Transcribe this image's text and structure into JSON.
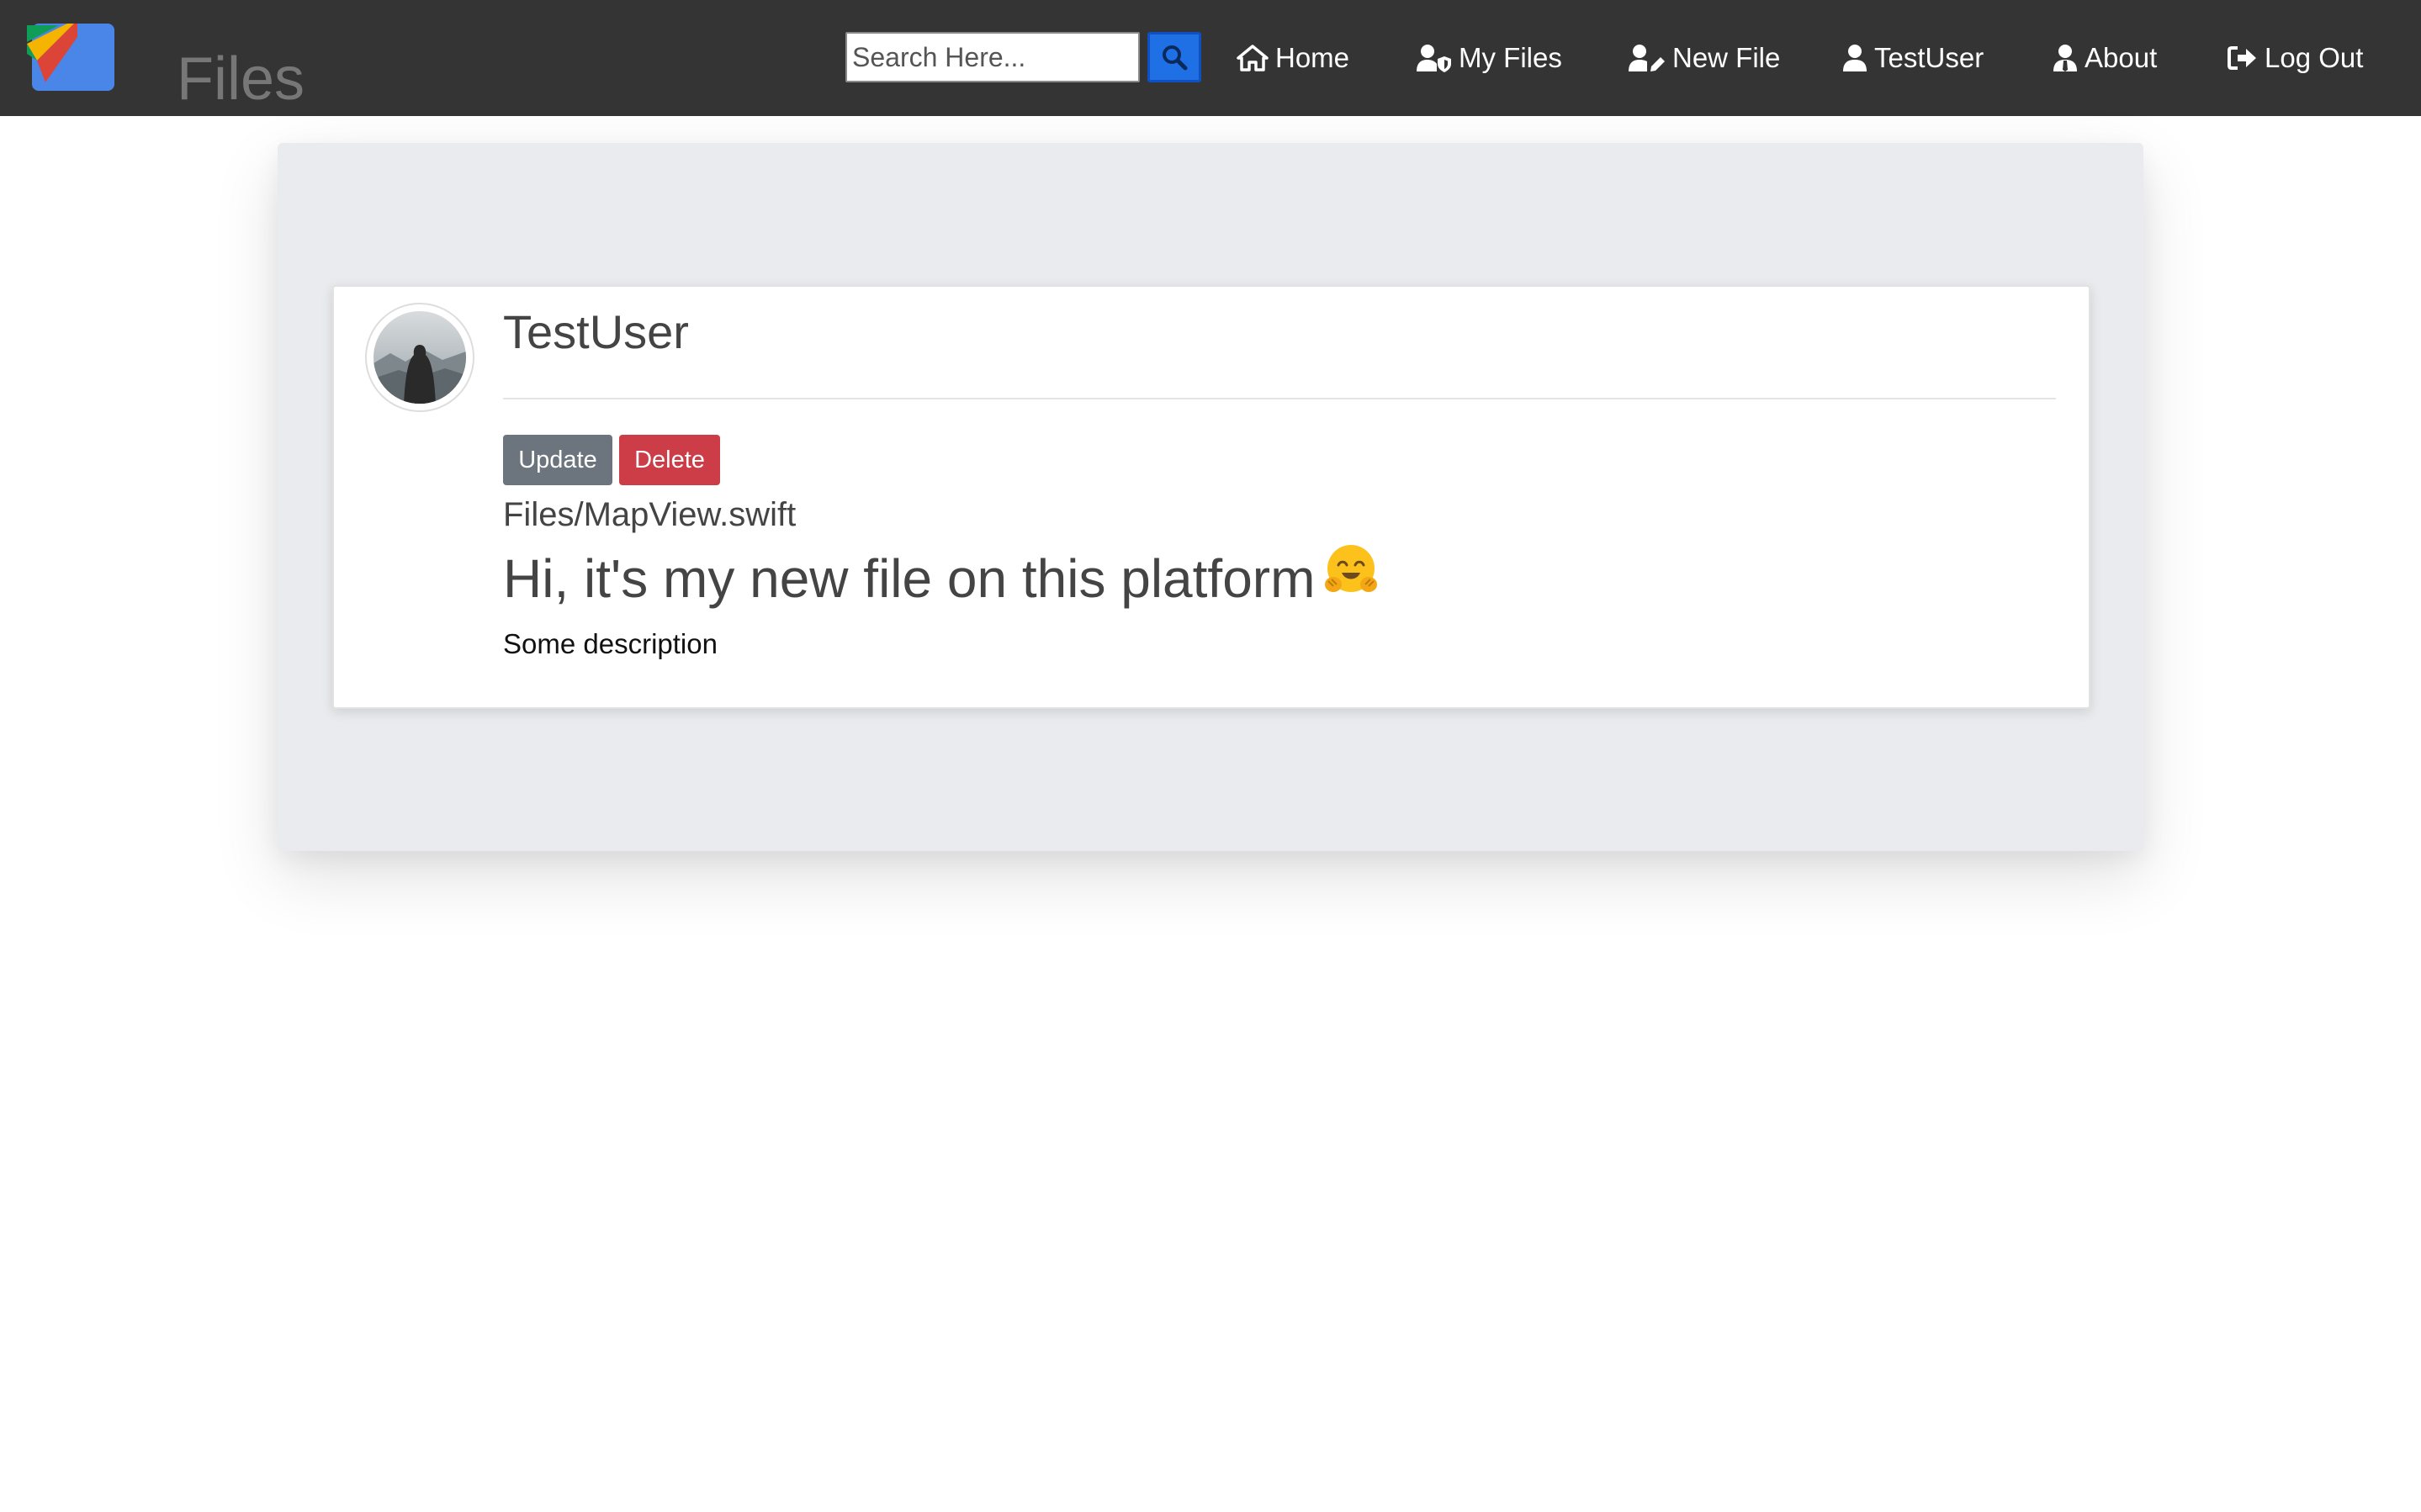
{
  "navbar": {
    "brand": "Files",
    "search_placeholder": "Search Here...",
    "items": [
      {
        "label": "Home",
        "icon": "home-icon"
      },
      {
        "label": "My Files",
        "icon": "user-shield-icon"
      },
      {
        "label": "New File",
        "icon": "user-edit-icon"
      },
      {
        "label": "TestUser",
        "icon": "user-icon"
      },
      {
        "label": "About",
        "icon": "user-tie-icon"
      },
      {
        "label": "Log Out",
        "icon": "sign-out-icon"
      }
    ]
  },
  "post": {
    "author": "TestUser",
    "update_label": "Update",
    "delete_label": "Delete",
    "file_path": "Files/MapView.swift",
    "title": "Hi, it's my new file on this platform",
    "title_emoji": "hugging-face-emoji",
    "description": "Some description"
  },
  "colors": {
    "navbar_bg": "#343434",
    "search_button": "#1f6fe5",
    "update_button": "#6c757d",
    "delete_button": "#cc3d47",
    "panel_bg": "#e9ebee"
  }
}
